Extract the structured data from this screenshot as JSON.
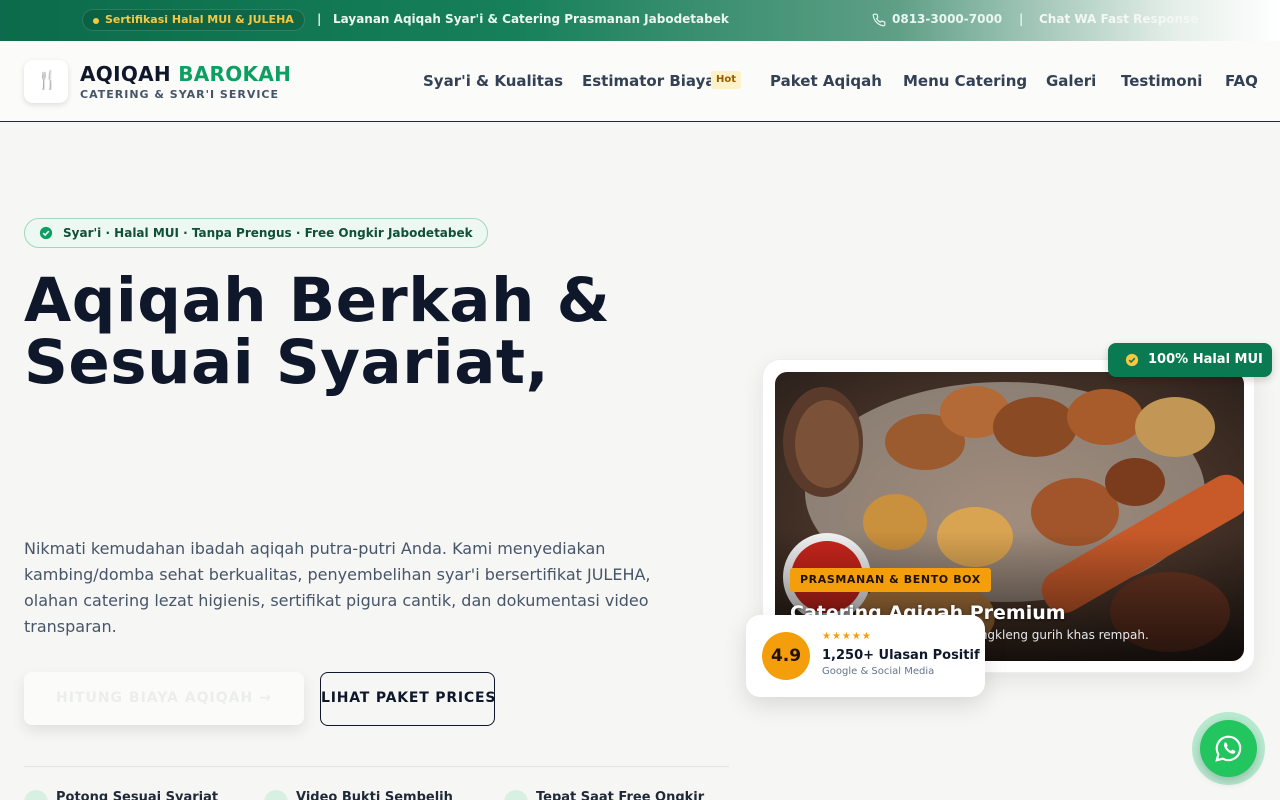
{
  "topbar": {
    "certification": "Sertifikasi Halal MUI & JULEHA",
    "separator": "|",
    "service": "Layanan Aqiqah Syar'i & Catering Prasmanan Jabodetabek",
    "phone": "0813-3000-7000",
    "whatsapp": "Chat WA Fast Response"
  },
  "header": {
    "brand_part1": "AQIQAH",
    "brand_part2": "BAROKAH",
    "tagline": "CATERING & SYAR'I SERVICE",
    "nav": [
      "Syar'i & Kualitas",
      "Estimator Biaya",
      "Paket Aqiqah",
      "Menu Catering",
      "Galeri",
      "Testimoni",
      "FAQ"
    ],
    "hot_badge": "Hot"
  },
  "hero": {
    "pill": "Syar'i · Halal MUI · Tanpa Prengus · Free Ongkir Jabodetabek",
    "headline_line1": "Aqiqah Berkah &",
    "headline_line2": "Sesuai Syariat,",
    "lead": "Nikmati kemudahan ibadah aqiqah putra-putri Anda. Kami menyediakan kambing/domba sehat berkualitas, penyembelihan syar'i bersertifikat JULEHA, olahan catering lezat higienis, sertifikat pigura cantik, dan dokumentasi video transparan.",
    "cta_primary": "HITUNG BIAYA AQIQAH →",
    "cta_secondary": "LIHAT PAKET PRICES",
    "features": [
      "Potong Sesuai Syariat",
      "Video Bukti Sembelih",
      "Tepat Saat Free Ongkir"
    ]
  },
  "showcase": {
    "halal_badge": "100% Halal MUI",
    "tag": "PRASMANAN & BENTO BOX",
    "title": "Catering Aqiqah Premium",
    "subtitle": "Sate, Gulai, Tongseng, Sop & Tengkleng gurih khas rempah.",
    "rating": {
      "score": "4.9",
      "stars": "★★★★★",
      "title": "1,250+ Ulasan Positif",
      "source": "Google & Social Media"
    }
  },
  "colors": {
    "brand_green": "#0d9f62",
    "badge_green": "#0a7a52",
    "accent_amber": "#f59e0b",
    "whatsapp": "#22c55e"
  }
}
